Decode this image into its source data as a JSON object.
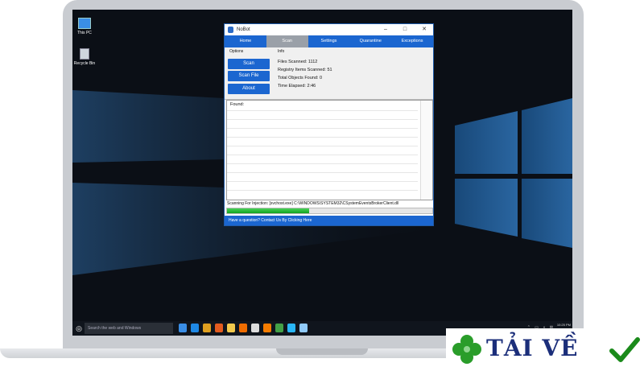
{
  "desktop": {
    "icons": [
      {
        "label": "This PC",
        "icon": "monitor-icon"
      },
      {
        "label": "Recycle Bin",
        "icon": "recycle-bin-icon"
      }
    ]
  },
  "window": {
    "title": "NoBot",
    "controls": {
      "minimize": "–",
      "maximize": "□",
      "close": "✕"
    },
    "tabs": [
      {
        "label": "Home",
        "active": false
      },
      {
        "label": "Scan",
        "active": true
      },
      {
        "label": "Settings",
        "active": false
      },
      {
        "label": "Quarantine",
        "active": false
      },
      {
        "label": "Exceptions",
        "active": false
      }
    ],
    "options_label": "Options",
    "info_label": "Info",
    "buttons": {
      "scan": "Scan",
      "scan_file": "Scan File",
      "about": "About"
    },
    "info": {
      "files_scanned": "Files Scanned: 1112",
      "registry_items": "Registry Items Scanned: 51",
      "total_objects": "Total Objects Found: 0",
      "time_elapsed": "Time Elapsed: 2:46"
    },
    "found_label": "Found:",
    "status_text": "Scanning For Injection: [svchost.exe] C:\\WINDOWS\\SYSTEM32\\CSystemEventsBrokerClient.dll",
    "progress": 0.4,
    "footer_link": "Have a question? Contact Us By Clicking Here"
  },
  "taskbar": {
    "start_glyph": "◎",
    "search_placeholder": "Search the web and Windows",
    "tray_icons": "⌃ ▭ ◖ ✉",
    "time": "10:25 PM",
    "date": "06/13/2016"
  },
  "logo": {
    "text": "TẢI VỀ"
  },
  "colors": {
    "accent": "#1b66d0",
    "progress": "#2fc43e",
    "desktop_bg": "#0b0f16",
    "logo_text": "#1b2e7a",
    "logo_green": "#2a9d2a"
  }
}
